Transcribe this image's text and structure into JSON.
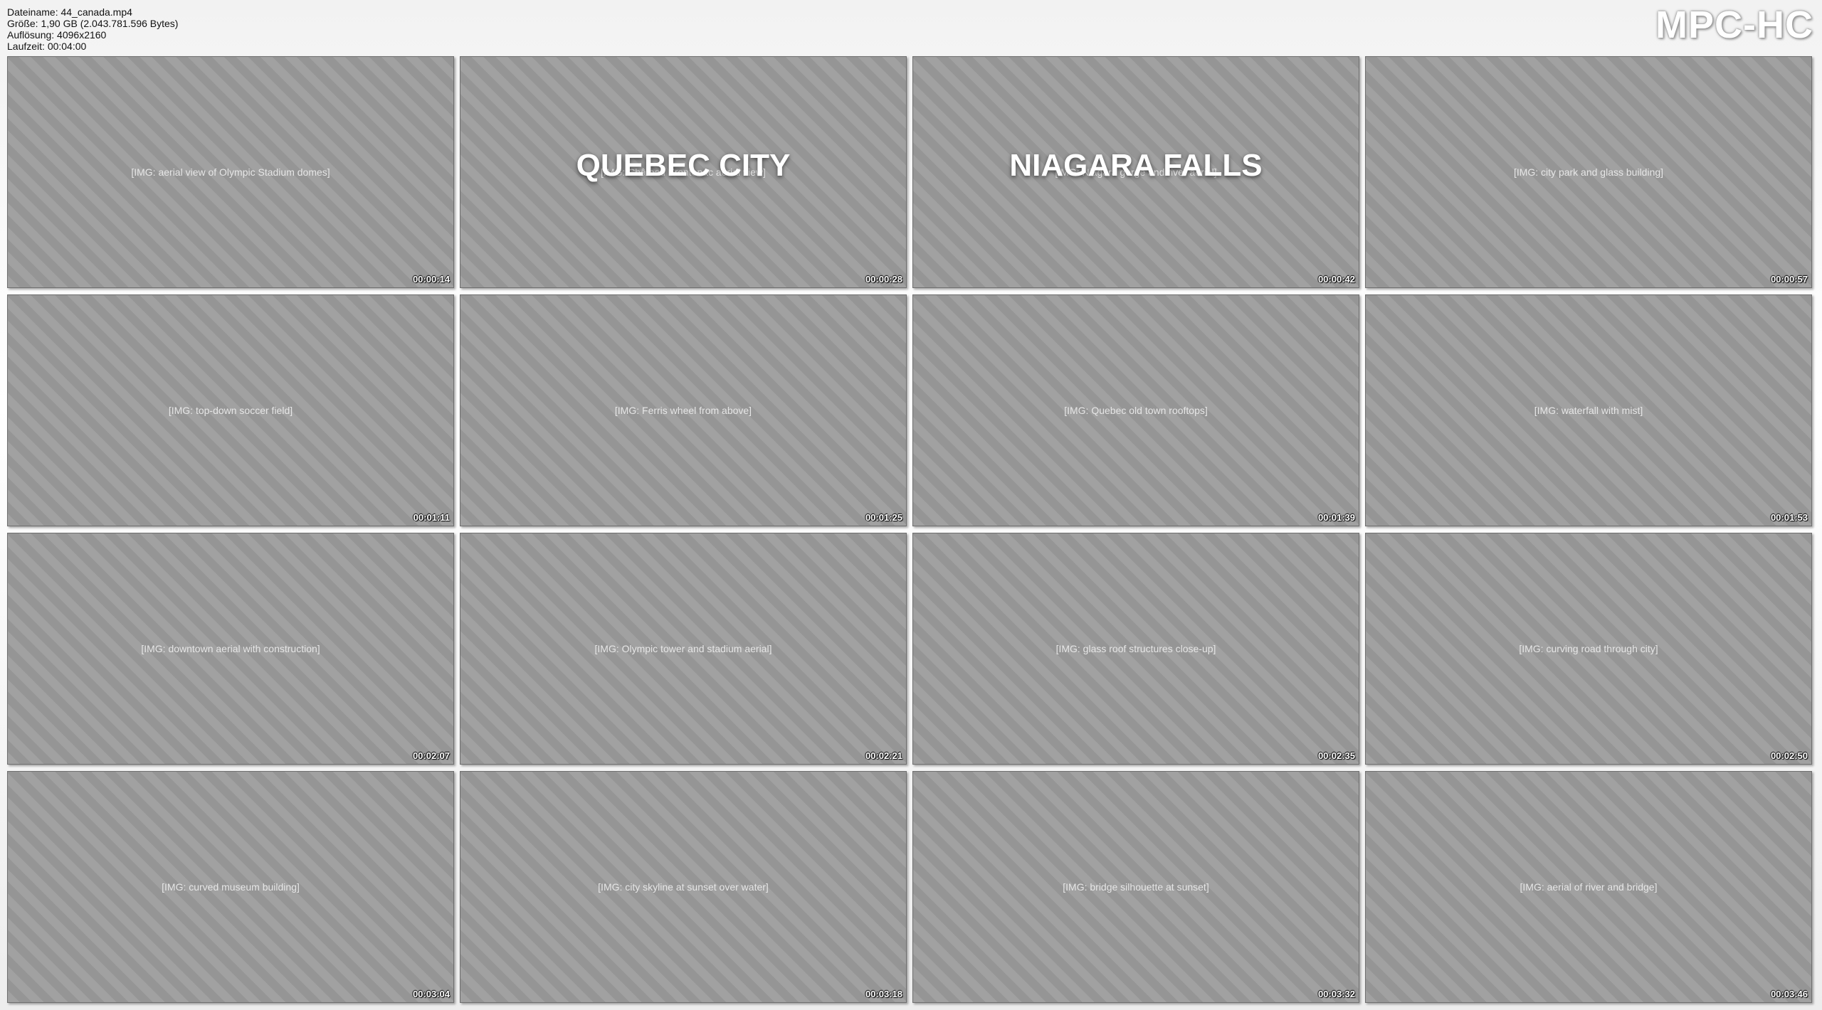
{
  "header": {
    "filename": "Dateiname: 44_canada.mp4",
    "size": "Größe: 1,90 GB (2.043.781.596 Bytes)",
    "resolution": "Auflösung: 4096x2160",
    "duration": "Laufzeit: 00:04:00"
  },
  "logo": "MPC-HC",
  "thumbnails": [
    {
      "time": "00:00:14",
      "overlay": ""
    },
    {
      "time": "00:00:28",
      "overlay": "QUEBEC CITY"
    },
    {
      "time": "00:00:42",
      "overlay": "NIAGARA FALLS"
    },
    {
      "time": "00:00:57",
      "overlay": ""
    },
    {
      "time": "00:01:11",
      "overlay": ""
    },
    {
      "time": "00:01:25",
      "overlay": ""
    },
    {
      "time": "00:01:39",
      "overlay": ""
    },
    {
      "time": "00:01:53",
      "overlay": ""
    },
    {
      "time": "00:02:07",
      "overlay": ""
    },
    {
      "time": "00:02:21",
      "overlay": ""
    },
    {
      "time": "00:02:35",
      "overlay": ""
    },
    {
      "time": "00:02:50",
      "overlay": ""
    },
    {
      "time": "00:03:04",
      "overlay": ""
    },
    {
      "time": "00:03:18",
      "overlay": ""
    },
    {
      "time": "00:03:32",
      "overlay": ""
    },
    {
      "time": "00:03:46",
      "overlay": ""
    }
  ]
}
